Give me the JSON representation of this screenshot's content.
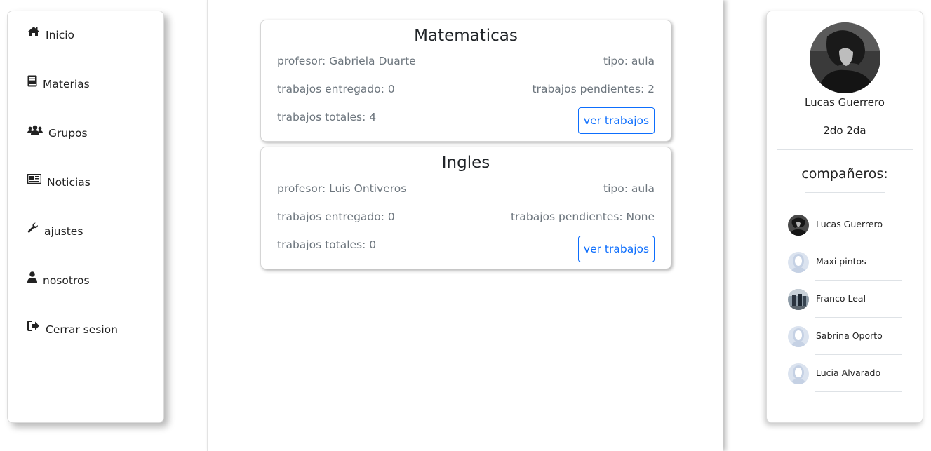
{
  "sidebar": {
    "items": [
      {
        "label": "Inicio",
        "icon": "home-icon"
      },
      {
        "label": "Materias",
        "icon": "book-icon"
      },
      {
        "label": "Grupos",
        "icon": "users-icon"
      },
      {
        "label": "Noticias",
        "icon": "newspaper-icon"
      },
      {
        "label": "ajustes",
        "icon": "wrench-icon"
      },
      {
        "label": "nosotros",
        "icon": "user-icon"
      },
      {
        "label": "Cerrar sesion",
        "icon": "sign-out-icon"
      }
    ]
  },
  "subjects": [
    {
      "title": "Matematicas",
      "teacher": "profesor: Gabriela Duarte",
      "type": "tipo: aula",
      "delivered": "trabajos entregado: 0",
      "pending": "trabajos pendientes: 2",
      "total": "trabajos totales: 4",
      "button": "ver trabajos"
    },
    {
      "title": "Ingles",
      "teacher": "profesor: Luis Ontiveros",
      "type": "tipo: aula",
      "delivered": "trabajos entregado: 0",
      "pending": "trabajos pendientes: None",
      "total": "trabajos totales: 0",
      "button": "ver trabajos"
    }
  ],
  "profile": {
    "name": "Lucas Guerrero",
    "course": "2do 2da",
    "classmates_title": "compañeros:",
    "classmates": [
      {
        "name": "Lucas Guerrero",
        "avatar": "photo-dark"
      },
      {
        "name": "Maxi pintos",
        "avatar": "placeholder"
      },
      {
        "name": "Franco Leal",
        "avatar": "photo-group"
      },
      {
        "name": "Sabrina Oporto",
        "avatar": "placeholder"
      },
      {
        "name": "Lucia Alvarado",
        "avatar": "placeholder"
      }
    ]
  },
  "colors": {
    "accent": "#0d6efd",
    "muted_text": "#6c757d",
    "placeholder_avatar": "#c5d1e4"
  }
}
